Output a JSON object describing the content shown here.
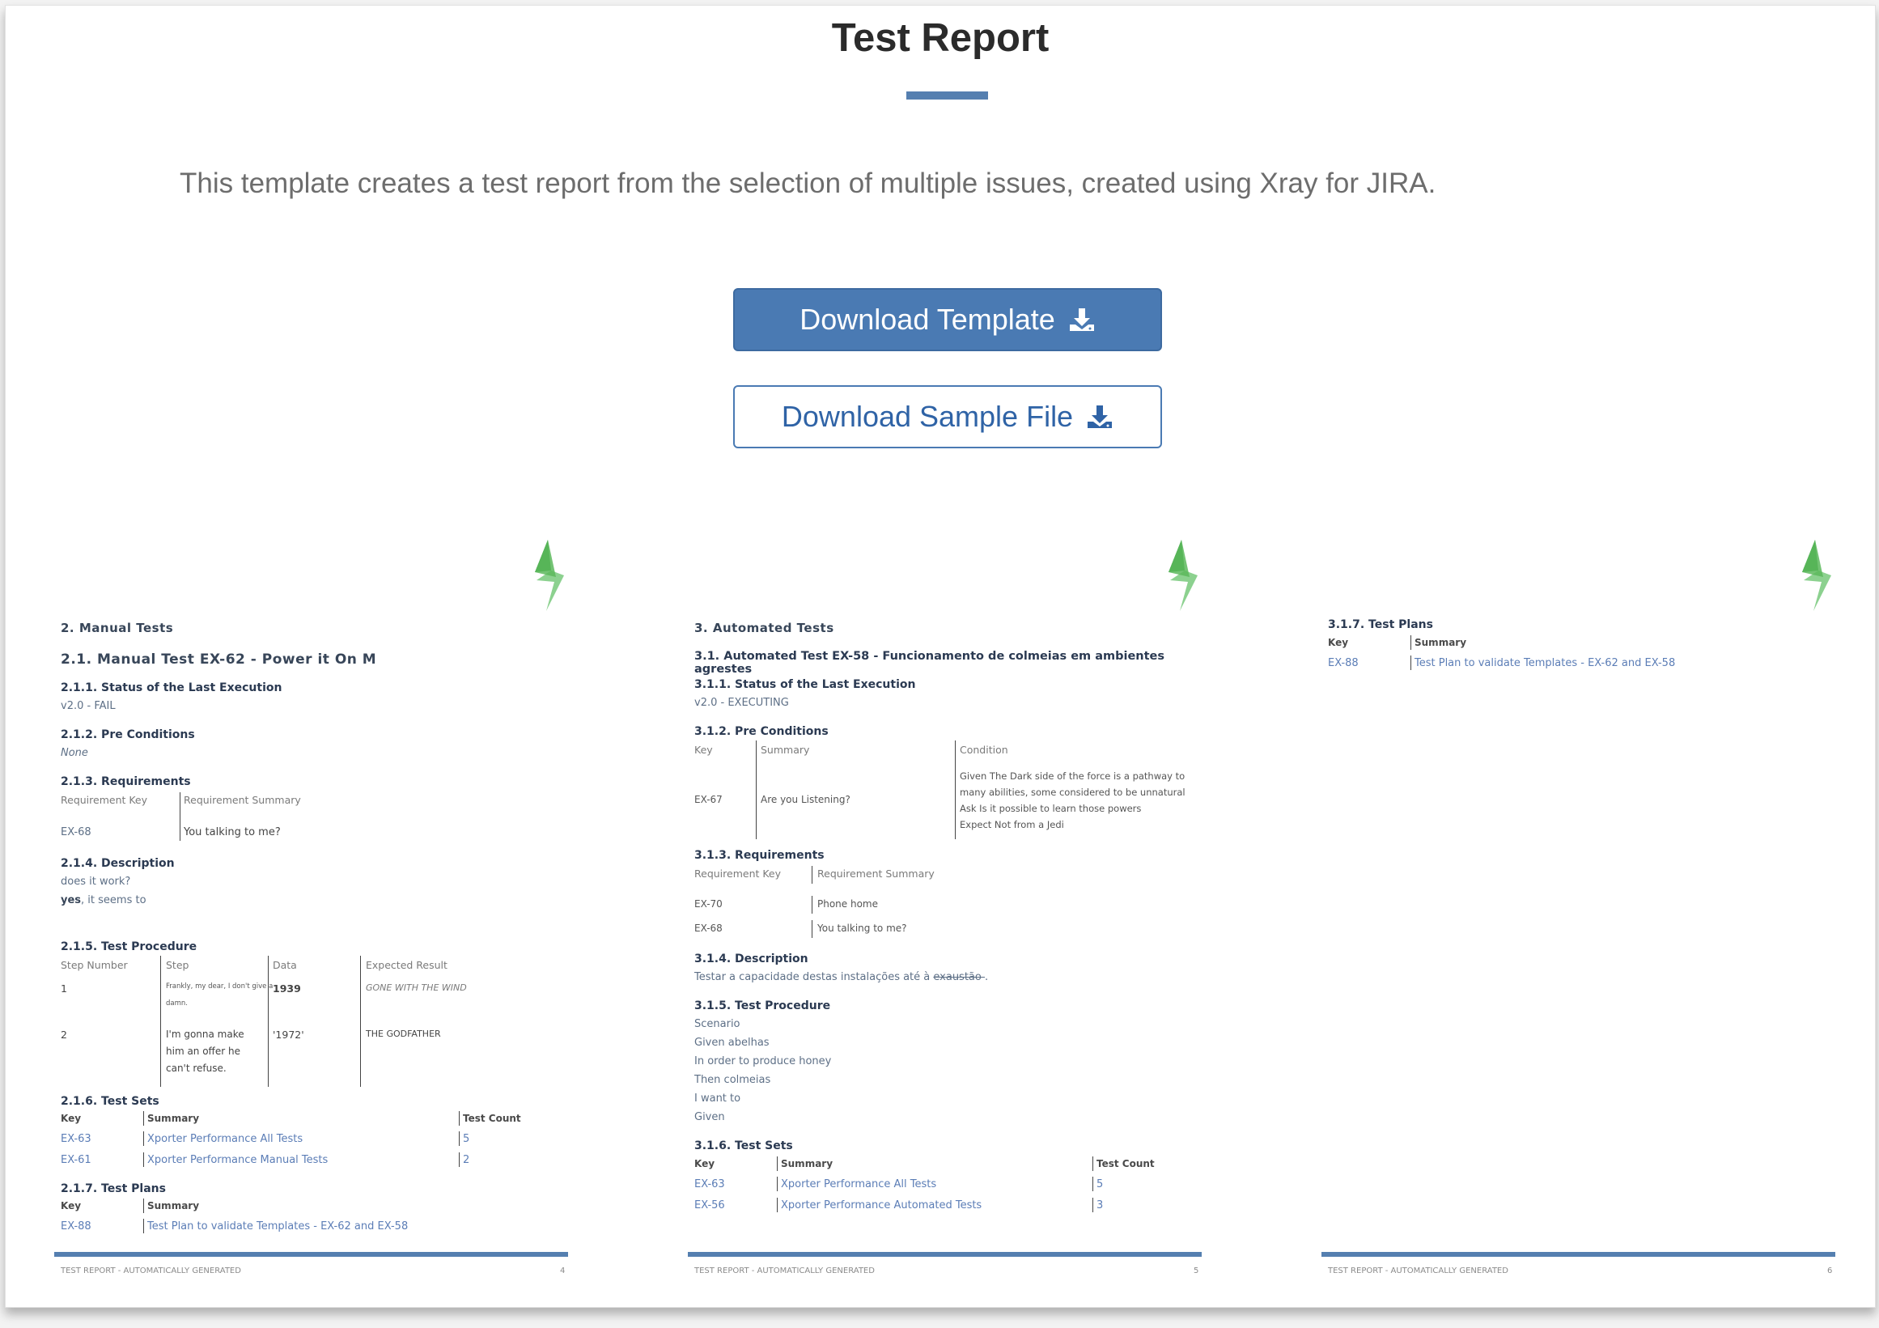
{
  "page_title": "Test Report",
  "intro": "This template creates a test report from the selection of multiple issues, created using Xray for JIRA.",
  "buttons": {
    "download_template": "Download Template",
    "download_sample": "Download Sample File"
  },
  "colors": {
    "primary": "#4a7ab3",
    "accent_bar": "#557fb0",
    "bolt_green": "#4caf50"
  },
  "icons": {
    "download": "download-icon",
    "logo": "lightning-bolt-icon"
  },
  "footer_text": "TEST REPORT - AUTOMATICALLY GENERATED",
  "p1": {
    "page_num": "4",
    "h_manual": "2.  Manual Tests",
    "h_test": "2.1.  Manual Test EX-62 - Power it On M",
    "s_status": "2.1.1.   Status of the Last Execution",
    "status_val": "v2.0 - FAIL",
    "s_pre": "2.1.2.   Pre Conditions",
    "pre_val": "None",
    "s_req": "2.1.3.   Requirements",
    "req_col1": "Requirement Key",
    "req_col2": "Requirement Summary",
    "req_row_key": "EX-68",
    "req_row_sum": "You talking to me?",
    "s_desc": "2.1.4.   Description",
    "desc_line1": "does it work?",
    "desc_yes": "yes",
    "desc_rest": ", it seems to",
    "s_proc": "2.1.5.   Test Procedure",
    "proc_cols": [
      "Step Number",
      "Step",
      "Data",
      "Expected Result"
    ],
    "proc_row1": {
      "num": "1",
      "step_a": "Frankly, my dear, I don't give a",
      "step_b": "damn.",
      "data": "1939",
      "result": "GONE WITH THE WIND"
    },
    "proc_row2": {
      "num": "2",
      "step_a": "I'm gonna make",
      "step_b": "him an offer he",
      "step_c": "can't refuse.",
      "data": "'1972'",
      "result": "THE GODFATHER"
    },
    "s_sets": "2.1.6.   Test Sets",
    "sets_cols": [
      "Key",
      "Summary",
      "Test Count"
    ],
    "sets_rows": [
      {
        "key": "EX-63",
        "summary": "Xporter Performance All Tests",
        "count": "5"
      },
      {
        "key": "EX-61",
        "summary": "Xporter Performance Manual Tests",
        "count": "2"
      }
    ],
    "s_plans": "2.1.7.   Test Plans",
    "plans_cols": [
      "Key",
      "Summary"
    ],
    "plans_row": {
      "key": "EX-88",
      "summary": "Test Plan to validate Templates - EX-62 and EX-58"
    }
  },
  "p2": {
    "page_num": "5",
    "h_auto": "3.   Automated Tests",
    "h_test": "3.1.   Automated Test EX-58 - Funcionamento de colmeias em ambientes agrestes",
    "s_status": "3.1.1.   Status of the Last Execution",
    "status_val": "v2.0 - EXECUTING",
    "s_pre": "3.1.2.   Pre Conditions",
    "pre_cols": [
      "Key",
      "Summary",
      "Condition"
    ],
    "pre_row": {
      "key": "EX-67",
      "summary": "Are you Listening?",
      "cond": [
        "Given The Dark side of the force is a pathway to",
        "many abilities, some considered to be unnatural",
        "Ask Is it possible to learn those powers",
        "Expect Not from a Jedi"
      ]
    },
    "s_req": "3.1.3.   Requirements",
    "req_cols": [
      "Requirement Key",
      "Requirement Summary"
    ],
    "req_rows": [
      {
        "key": "EX-70",
        "summary": "Phone home"
      },
      {
        "key": "EX-68",
        "summary": "You talking to me?"
      }
    ],
    "s_desc": "3.1.4.   Description",
    "desc_main": "Testar a capacidade destas instalações até à ",
    "desc_strike": "exaustão ",
    "desc_end": ".",
    "s_proc": "3.1.5.   Test Procedure",
    "proc_lines": [
      "Scenario",
      "Given abelhas",
      "In order to produce honey",
      "Then colmeias",
      "I want to",
      "Given"
    ],
    "s_sets": "3.1.6.   Test Sets",
    "sets_cols": [
      "Key",
      "Summary",
      "Test Count"
    ],
    "sets_rows": [
      {
        "key": "EX-63",
        "summary": "Xporter Performance All Tests",
        "count": "5"
      },
      {
        "key": "EX-56",
        "summary": "Xporter Performance Automated Tests",
        "count": "3"
      }
    ]
  },
  "p3": {
    "page_num": "6",
    "s_plans": "3.1.7.   Test Plans",
    "plans_cols": [
      "Key",
      "Summary"
    ],
    "plans_row": {
      "key": "EX-88",
      "summary": "Test Plan to validate Templates - EX-62 and EX-58"
    }
  }
}
